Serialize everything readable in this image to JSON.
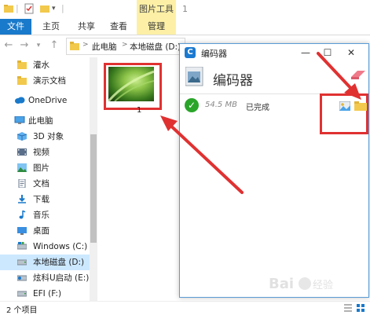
{
  "title_bar": {
    "context_tab": "图片工具",
    "window_number": "1"
  },
  "ribbon": {
    "tabs": [
      {
        "label": "文件"
      },
      {
        "label": "主页"
      },
      {
        "label": "共享"
      },
      {
        "label": "查看"
      },
      {
        "label": "管理"
      }
    ]
  },
  "address": {
    "crumbs": [
      "此电脑",
      "本地磁盘 (D:)"
    ],
    "separator": ">"
  },
  "nav_pane": {
    "items": [
      {
        "label": "灌水",
        "icon": "folder-icon"
      },
      {
        "label": "演示文档",
        "icon": "folder-icon"
      },
      {
        "label": "OneDrive",
        "icon": "cloud-icon"
      },
      {
        "label": "此电脑",
        "icon": "computer-icon"
      },
      {
        "label": "3D 对象",
        "icon": "3d-objects-icon"
      },
      {
        "label": "视频",
        "icon": "video-icon"
      },
      {
        "label": "图片",
        "icon": "pictures-icon"
      },
      {
        "label": "文档",
        "icon": "documents-icon"
      },
      {
        "label": "下载",
        "icon": "download-icon"
      },
      {
        "label": "音乐",
        "icon": "music-icon"
      },
      {
        "label": "桌面",
        "icon": "desktop-icon"
      },
      {
        "label": "Windows (C:)",
        "icon": "drive-icon"
      },
      {
        "label": "本地磁盘 (D:)",
        "icon": "drive-icon",
        "selected": true
      },
      {
        "label": "炫科U启动 (E:)",
        "icon": "usb-drive-icon"
      },
      {
        "label": "EFI (F:)",
        "icon": "drive-icon"
      }
    ]
  },
  "content": {
    "files": [
      {
        "name": "1",
        "type": "image"
      }
    ]
  },
  "status_bar": {
    "item_count": "2 个项目"
  },
  "encoder": {
    "title": "编码器",
    "heading": "编码器",
    "task": {
      "size": "54.5 MB",
      "status": "已完成"
    }
  },
  "watermark": {
    "text": "Baidu 经验"
  },
  "colors": {
    "accent_blue": "#1979ca",
    "context_yellow": "#fdf0a6",
    "highlight_red": "#e03131",
    "success_green": "#2aa52a",
    "selection": "#cce8ff"
  }
}
